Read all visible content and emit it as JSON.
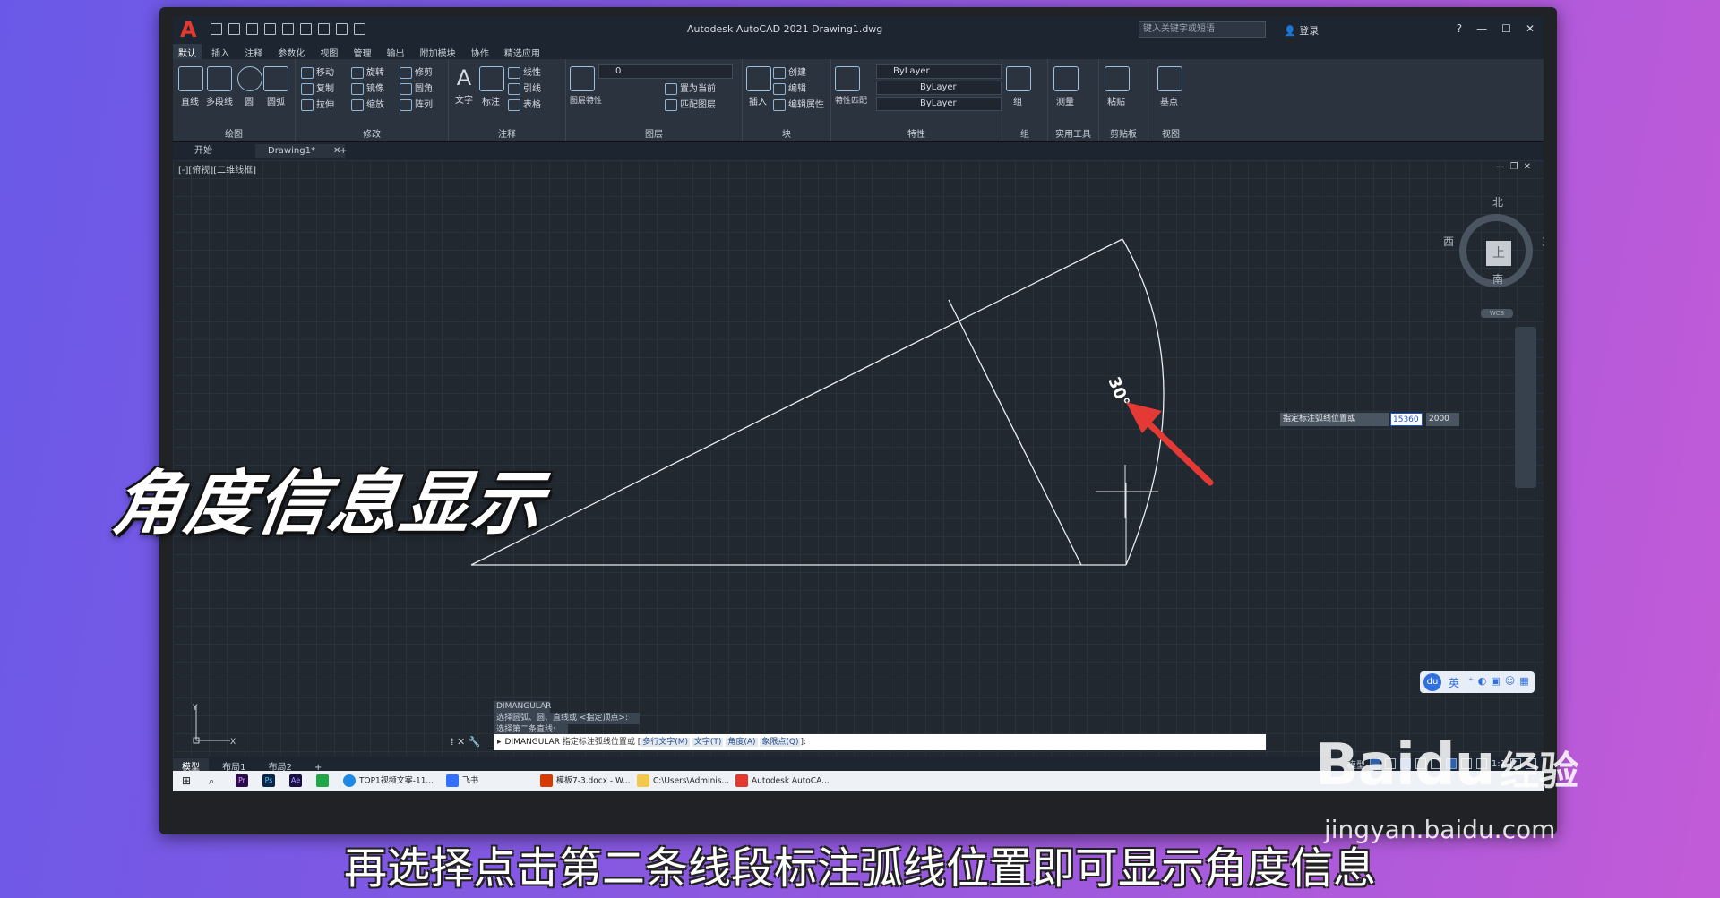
{
  "app": {
    "title": "Autodesk AutoCAD 2021    Drawing1.dwg",
    "search_placeholder": "键入关键字或短语",
    "login": "登录",
    "logo": "A"
  },
  "menu_tabs": [
    "默认",
    "插入",
    "注释",
    "参数化",
    "视图",
    "管理",
    "输出",
    "附加模块",
    "协作",
    "精选应用"
  ],
  "ribbon": {
    "draw": {
      "label": "绘图",
      "line": "直线",
      "polyline": "多段线",
      "circle": "圆",
      "arc": "圆弧"
    },
    "modify": {
      "label": "修改",
      "move": "移动",
      "rotate": "旋转",
      "trim": "修剪",
      "copy": "复制",
      "mirror": "镜像",
      "fillet": "圆角",
      "stretch": "拉伸",
      "scale": "缩放",
      "array": "阵列"
    },
    "annotation": {
      "label": "注释",
      "text": "文字",
      "dimension": "标注",
      "linear": "线性",
      "leader": "引线",
      "table": "表格"
    },
    "layers": {
      "label": "图层",
      "layer_props": "图层特性",
      "current_layer": "0",
      "make_current": "置为当前",
      "match_layer": "匹配图层"
    },
    "block": {
      "label": "块",
      "insert": "插入",
      "create": "创建",
      "edit": "编辑",
      "edit_attr": "编辑属性"
    },
    "properties": {
      "label": "特性",
      "match": "特性匹配",
      "color": "ByLayer",
      "linetype": "ByLayer",
      "lineweight": "ByLayer"
    },
    "groups": {
      "label": "组",
      "group": "组"
    },
    "utilities": {
      "label": "实用工具",
      "measure": "测量"
    },
    "clipboard": {
      "label": "剪贴板",
      "paste": "粘贴"
    },
    "view": {
      "label": "视图",
      "base": "基点"
    }
  },
  "file_tabs": [
    "开始",
    "Drawing1*"
  ],
  "viewport": {
    "label": "[-][俯视][二维线框]",
    "viewcube": {
      "north": "北",
      "south": "南",
      "east": "东",
      "west": "西",
      "top": "上",
      "wcs": "WCS"
    },
    "dimension_text": "30°",
    "dynamic_prompt": "指定标注弧线位置或",
    "dynamic_value1": "15360",
    "dynamic_value2": "2000"
  },
  "command": {
    "history": [
      "DIMANGULAR",
      "选择圆弧、圆、直线或 <指定顶点>:",
      "选择第二条直线:"
    ],
    "prompt_cmd": "DIMANGULAR",
    "prompt_text": "指定标注弧线位置或",
    "options": [
      "多行文字(M)",
      "文字(T)",
      "角度(A)",
      "象限点(Q)"
    ],
    "suffix": "]:"
  },
  "layout_tabs": [
    "模型",
    "布局1",
    "布局2"
  ],
  "status": {
    "model": "模型",
    "scale": "1:1"
  },
  "ime": {
    "logo": "du",
    "lang": "英"
  },
  "taskbar": {
    "items": [
      {
        "label": "TOP1视频文案-11...",
        "color": "#1e88e5"
      },
      {
        "label": "飞书",
        "color": "#3370ff"
      },
      {
        "label": "模板7-3.docx - W...",
        "color": "#d83b01"
      },
      {
        "label": "C:\\Users\\Adminis...",
        "color": "#f2c94c"
      },
      {
        "label": "Autodesk AutoCA...",
        "color": "#e23a2f"
      }
    ],
    "apps": [
      "Pr",
      "Ps",
      "Ae"
    ]
  },
  "overlay": {
    "title": "角度信息显示",
    "subtitle": "再选择点击第二条线段标注弧线位置即可显示角度信息"
  },
  "watermark": {
    "brand": "Baidu",
    "brand_cn": "经验",
    "url": "jingyan.baidu.com"
  },
  "colors": {
    "arrow": "#e53935",
    "accent": "#2f5fa8",
    "cad_bg": "#212830"
  }
}
